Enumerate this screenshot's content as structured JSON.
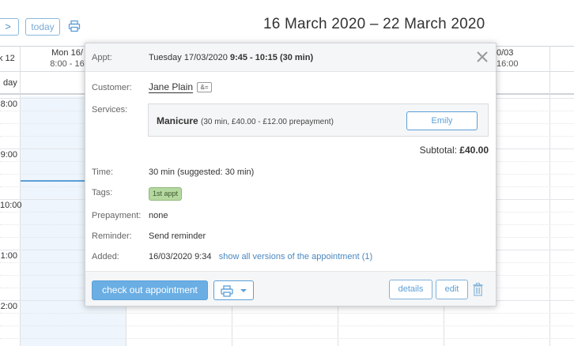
{
  "toolbar": {
    "next_label": ">",
    "today_label": "today",
    "print_icon": "print-icon",
    "range_title": "16 March 2020 – 22 March 2020"
  },
  "calendar": {
    "cut_prev_label": "k 12",
    "columns": [
      {
        "line1": "Mon 16/",
        "line2": "8:00 - 16"
      },
      {
        "line1": "0/03",
        "line2": "16:00"
      }
    ],
    "allday_label": "day",
    "time_labels": [
      "8:00",
      "9:00",
      "10:00",
      "1:00",
      "2:00"
    ],
    "colors": {
      "today_bg": "#eef5fc",
      "now_line": "#5b9fd8"
    }
  },
  "popup": {
    "appt_label": "Appt:",
    "appt_date": "Tuesday 17/03/2020",
    "appt_time": "9:45 - 10:15 (30 min)",
    "close_icon": "close-icon",
    "customer_label": "Customer:",
    "customer_name": "Jane Plain",
    "customer_card_icon": "contact-card-icon",
    "customer_card_text": "&=",
    "services_label": "Services:",
    "service_name": "Manicure",
    "service_detail": "(30 min, £40.00 - £12.00 prepayment)",
    "staff_name": "Emily",
    "subtotal_label": "Subtotal:",
    "subtotal_value": "£40.00",
    "time_label": "Time:",
    "time_value": "30 min (suggested: 30 min)",
    "tags_label": "Tags:",
    "tag_value": "1st appt",
    "prepayment_label": "Prepayment:",
    "prepayment_value": "none",
    "reminder_label": "Reminder:",
    "reminder_value": "Send reminder",
    "added_label": "Added:",
    "added_value": "16/03/2020 9:34",
    "versions_link": "show all versions of the appointment (1)",
    "checkout_label": "check out appointment",
    "details_label": "details",
    "edit_label": "edit",
    "trash_icon": "trash-icon",
    "colors": {
      "primary": "#6aaee4",
      "tag_bg": "#b5d8a0"
    }
  }
}
